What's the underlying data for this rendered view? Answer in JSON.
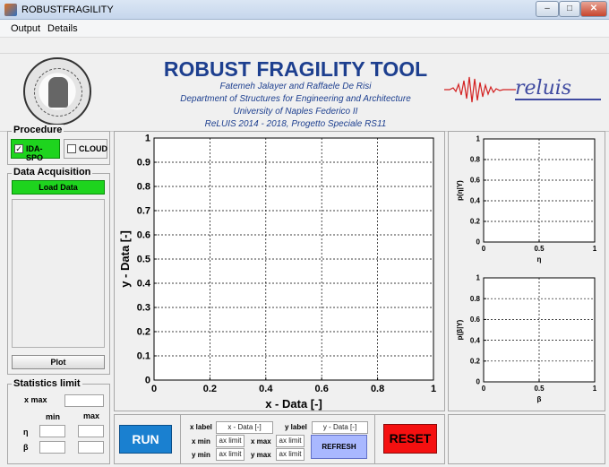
{
  "window": {
    "title": "ROBUSTFRAGILITY",
    "min_icon": "minimize-icon",
    "max_icon": "maximize-icon",
    "close_icon": "close-icon"
  },
  "menu": {
    "items": [
      "Output",
      "Details"
    ]
  },
  "header": {
    "title": "ROBUST FRAGILITY TOOL",
    "lines": [
      "Fatemeh Jalayer and Raffaele De Risi",
      "Department of Structures for Engineering and Architecture",
      "University of Naples Federico II",
      "ReLUIS 2014 - 2018, Progetto Speciale RS11"
    ],
    "logo_text": "reluis"
  },
  "procedure": {
    "label": "Procedure",
    "ida_spo": "IDA-SPO",
    "ida_checked": true,
    "cloud": "CLOUD",
    "cloud_checked": false,
    "check_mark": "✓"
  },
  "acquisition": {
    "label": "Data Acquisition",
    "load": "Load Data",
    "plot": "Plot"
  },
  "statistics": {
    "label": "Statistics limit",
    "xmax": "x max",
    "min": "min",
    "max": "max",
    "eta": "η",
    "beta": "β"
  },
  "controls": {
    "run": "RUN",
    "reset": "RESET",
    "refresh": "REFRESH",
    "xlabel_label": "x label",
    "xlabel_value": "x - Data [-]",
    "ylabel_label": "y label",
    "ylabel_value": "y - Data [-]",
    "xmin_label": "x min",
    "xmax_label": "x max",
    "ymin_label": "y min",
    "ymax_label": "y max",
    "ax_limit": "ax limit"
  },
  "chart_data": [
    {
      "type": "line",
      "xlabel": "x - Data [-]",
      "ylabel": "y - Data [-]",
      "xlim": [
        0,
        1
      ],
      "ylim": [
        0,
        1
      ],
      "xticks": [
        "0",
        "0.2",
        "0.4",
        "0.6",
        "0.8",
        "1"
      ],
      "yticks": [
        "0",
        "0.1",
        "0.2",
        "0.3",
        "0.4",
        "0.5",
        "0.6",
        "0.7",
        "0.8",
        "0.9",
        "1"
      ],
      "grid": true,
      "series": []
    },
    {
      "type": "line",
      "xlabel": "η",
      "ylabel": "p(η|Y)",
      "xlim": [
        0,
        1
      ],
      "ylim": [
        0,
        1
      ],
      "xticks": [
        "0",
        "0.5",
        "1"
      ],
      "yticks": [
        "0",
        "0.2",
        "0.4",
        "0.6",
        "0.8",
        "1"
      ],
      "grid": true,
      "series": []
    },
    {
      "type": "line",
      "xlabel": "β",
      "ylabel": "p(β|Y)",
      "xlim": [
        0,
        1
      ],
      "ylim": [
        0,
        1
      ],
      "xticks": [
        "0",
        "0.5",
        "1"
      ],
      "yticks": [
        "0",
        "0.2",
        "0.4",
        "0.6",
        "0.8",
        "1"
      ],
      "grid": true,
      "series": []
    }
  ]
}
